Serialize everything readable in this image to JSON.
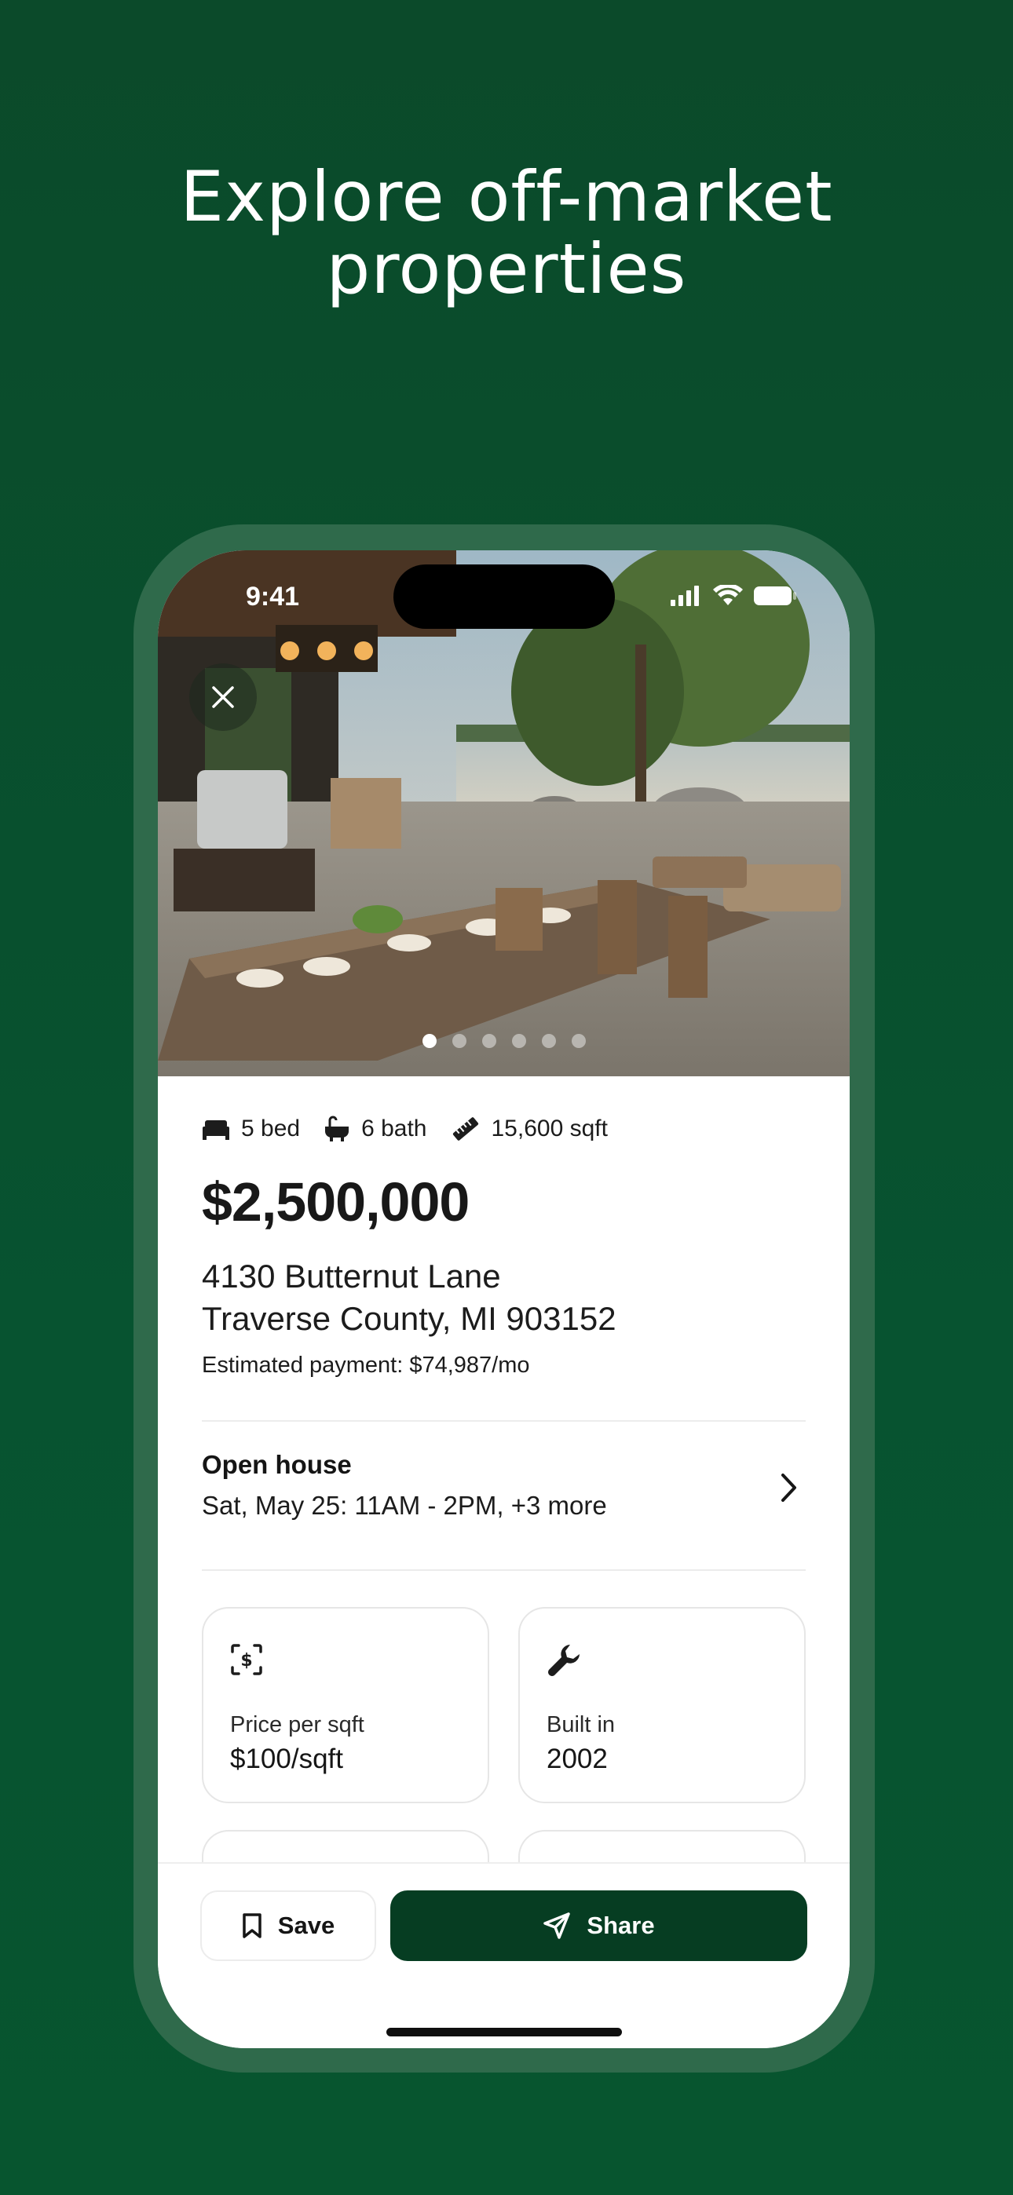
{
  "headline": {
    "line1": "Explore off-market",
    "line2": "properties"
  },
  "status_bar": {
    "time": "9:41"
  },
  "gallery": {
    "dot_count": 6,
    "active_index": 0
  },
  "listing": {
    "specs": {
      "beds": "5 bed",
      "baths": "6 bath",
      "area": "15,600 sqft"
    },
    "price": "$2,500,000",
    "address_line1": "4130 Butternut Lane",
    "address_line2": "Traverse County, MI 903152",
    "estimated_payment": "Estimated payment: $74,987/mo"
  },
  "open_house": {
    "title": "Open house",
    "detail": "Sat, May 25: 11AM - 2PM, +3 more"
  },
  "cards": [
    {
      "icon": "dollar-tag-icon",
      "label": "Price per sqft",
      "value": "$100/sqft"
    },
    {
      "icon": "wrench-icon",
      "label": "Built in",
      "value": "2002"
    }
  ],
  "actions": {
    "save_label": "Save",
    "share_label": "Share"
  },
  "colors": {
    "background": "#0b4a2a",
    "frame": "#2f6a4b",
    "primary_button": "#063d22",
    "text": "#161616"
  }
}
